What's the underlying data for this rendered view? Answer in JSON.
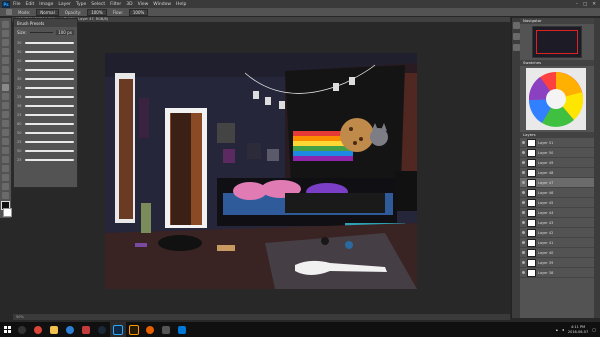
{
  "menubar": {
    "app_logo": "Ps",
    "items": [
      "File",
      "Edit",
      "Image",
      "Layer",
      "Type",
      "Select",
      "Filter",
      "3D",
      "View",
      "Window",
      "Help"
    ],
    "window_controls": [
      "–",
      "□",
      "✕"
    ]
  },
  "options": {
    "mode_label": "Mode:",
    "mode_value": "Normal",
    "opacity_label": "Opacity:",
    "opacity_value": "100%",
    "flow_label": "Flow:",
    "flow_value": "100%"
  },
  "brush_panel": {
    "title": "Brush Presets",
    "size_label": "Size:",
    "size_value": "100 px",
    "preset_numbers": [
      "30",
      "30",
      "30",
      "30",
      "30",
      "25",
      "25",
      "36",
      "25",
      "60",
      "50",
      "25",
      "50",
      "25"
    ]
  },
  "document": {
    "tab_title": "VACATION TIKTOK ESS.psd @ 50% (Layer 47, RGB/8)",
    "status": "50%"
  },
  "right_panels": {
    "navigator_title": "Navigator",
    "swatches_title": "Swatches",
    "layers_title": "Layers",
    "layers": [
      {
        "name": "Layer 51"
      },
      {
        "name": "Layer 50"
      },
      {
        "name": "Layer 49"
      },
      {
        "name": "Layer 48"
      },
      {
        "name": "Layer 47"
      },
      {
        "name": "Layer 46"
      },
      {
        "name": "Layer 45"
      },
      {
        "name": "Layer 44"
      },
      {
        "name": "Layer 43"
      },
      {
        "name": "Layer 42"
      },
      {
        "name": "Layer 41"
      },
      {
        "name": "Layer 40"
      },
      {
        "name": "Layer 39"
      },
      {
        "name": "Layer 38"
      }
    ]
  },
  "taskbar": {
    "apps": [
      "search",
      "chrome",
      "file-explorer",
      "edge",
      "media",
      "steam",
      "photoshop",
      "illustrator",
      "firefox",
      "store",
      "mail"
    ],
    "time": "4:11 PM",
    "date": "2016-06-07"
  },
  "colors": {
    "accent": "#31a8ff",
    "room_wall": "#2a2a3a",
    "floor": "#3a2323",
    "pink": "#e07bb4",
    "blanket": "#2f5b9b"
  }
}
